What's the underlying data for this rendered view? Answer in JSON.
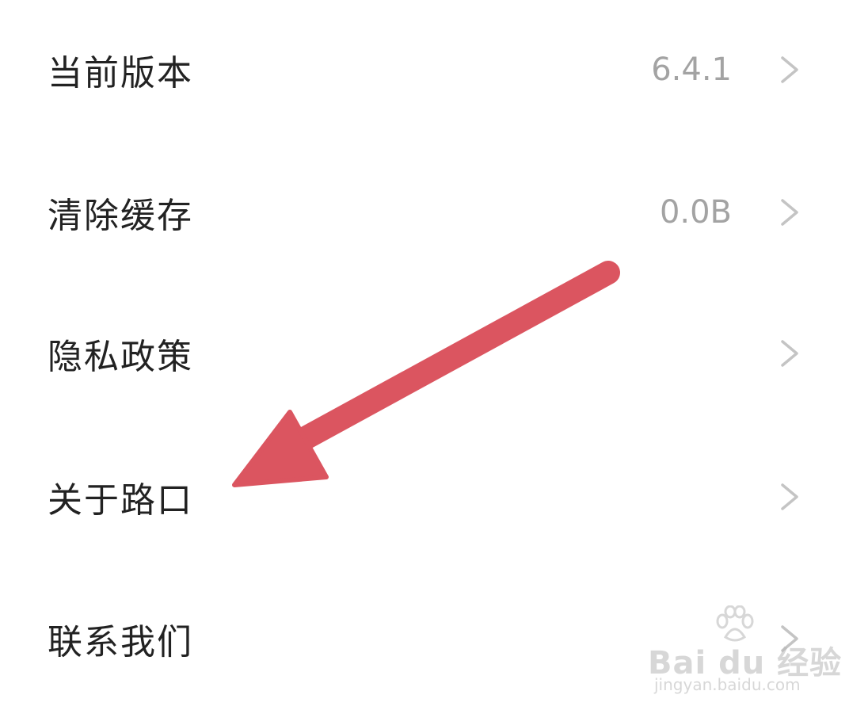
{
  "settings": {
    "items": [
      {
        "label": "当前版本",
        "value": "6.4.1"
      },
      {
        "label": "清除缓存",
        "value": "0.0B"
      },
      {
        "label": "隐私政策",
        "value": ""
      },
      {
        "label": "关于路口",
        "value": ""
      },
      {
        "label": "联系我们",
        "value": ""
      }
    ]
  },
  "watermark": {
    "brand": "Bai du 经验",
    "domain": "jingyan.baidu.com"
  },
  "colors": {
    "arrow": "#db5560",
    "label_text": "#222222",
    "value_text": "#a3a3a3",
    "chevron": "#c4c4c4"
  },
  "icons": {
    "chevron": "chevron-right-icon",
    "annotation": "red-arrow-annotation",
    "watermark_logo": "paw-print-icon"
  }
}
